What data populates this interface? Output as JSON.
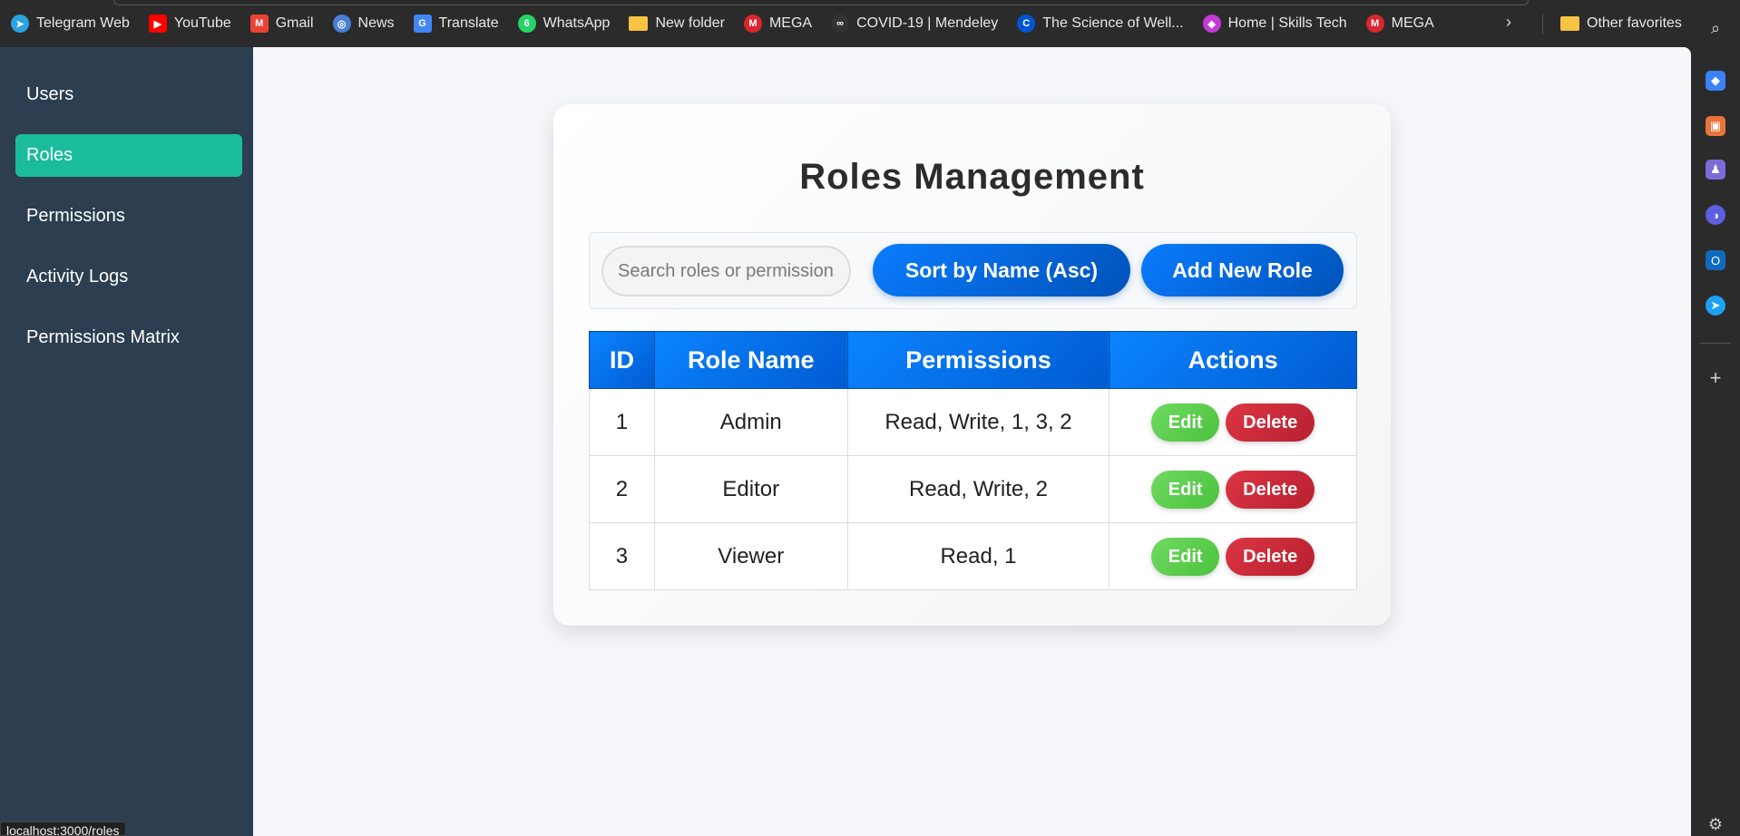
{
  "browser": {
    "bookmarks": [
      {
        "label": "Telegram Web",
        "icon": "telegram-icon",
        "color": "#2aa3df",
        "glyph": "➤",
        "shape": "round"
      },
      {
        "label": "YouTube",
        "icon": "youtube-icon",
        "color": "#ff0000",
        "glyph": "▶",
        "shape": "sq"
      },
      {
        "label": "Gmail",
        "icon": "gmail-icon",
        "color": "#ea4335",
        "glyph": "M",
        "shape": "sq"
      },
      {
        "label": "News",
        "icon": "news-icon",
        "color": "#4a7fd6",
        "glyph": "◎",
        "shape": "round"
      },
      {
        "label": "Translate",
        "icon": "translate-icon",
        "color": "#4285f4",
        "glyph": "G",
        "shape": "sq"
      },
      {
        "label": "WhatsApp",
        "icon": "whatsapp-icon",
        "color": "#25d366",
        "glyph": "6",
        "shape": "round"
      },
      {
        "label": "New folder",
        "icon": "folder-icon",
        "color": "#f6c343",
        "glyph": "",
        "shape": "folder"
      },
      {
        "label": "MEGA",
        "icon": "mega-icon",
        "color": "#d9272e",
        "glyph": "M",
        "shape": "round"
      },
      {
        "label": "COVID-19 | Mendeley",
        "icon": "mendeley-icon",
        "color": "#333333",
        "glyph": "∞",
        "shape": "round"
      },
      {
        "label": "The Science of Well...",
        "icon": "coursera-icon",
        "color": "#0056d2",
        "glyph": "C",
        "shape": "round"
      },
      {
        "label": "Home | Skills Tech",
        "icon": "skills-tech-icon",
        "color": "#c23bd4",
        "glyph": "◆",
        "shape": "round"
      },
      {
        "label": "MEGA",
        "icon": "mega-icon",
        "color": "#d9272e",
        "glyph": "M",
        "shape": "round"
      }
    ],
    "other_favorites": "Other favorites",
    "status_url": "localhost:3000/roles"
  },
  "sidebar": {
    "items": [
      {
        "label": "Users",
        "active": false
      },
      {
        "label": "Roles",
        "active": true
      },
      {
        "label": "Permissions",
        "active": false
      },
      {
        "label": "Activity Logs",
        "active": false
      },
      {
        "label": "Permissions Matrix",
        "active": false
      }
    ],
    "active_color": "#1abc9c",
    "background": "#2c3e50"
  },
  "page": {
    "title": "Roles Management",
    "search": {
      "placeholder": "Search roles or permissions",
      "value": ""
    },
    "sort_button": "Sort by Name (Asc)",
    "add_button": "Add New Role"
  },
  "table": {
    "headers": [
      "ID",
      "Role Name",
      "Permissions",
      "Actions"
    ],
    "rows": [
      {
        "id": "1",
        "name": "Admin",
        "permissions": "Read, Write, 1, 3, 2"
      },
      {
        "id": "2",
        "name": "Editor",
        "permissions": "Read, Write, 2"
      },
      {
        "id": "3",
        "name": "Viewer",
        "permissions": "Read, 1"
      }
    ],
    "edit_label": "Edit",
    "delete_label": "Delete"
  }
}
